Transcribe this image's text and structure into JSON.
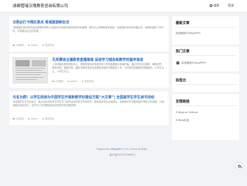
{
  "header": {
    "site_title": "成都管瑞汉瑰教育咨询有限公司",
    "search_label": "搜索",
    "login_label": "登录"
  },
  "posts": [
    {
      "title": "日照必打卡网红景点 青城旅游新玩法",
      "excerpt": "\"管理者的岗位职责及资质要求说明 以信息化手段推动组织的现代化管理，提升办公效率和服务质量，加强团队协作和沟通交流，营造和谐的工作环境，共同推动企业的发展。\"",
      "meta": [
        "1分钟前",
        "admin",
        "暂无评论"
      ]
    },
    {
      "title": "孔奕霖谈主播教育直播渠道 促进学习理念和教学的循序渐进",
      "excerpt": "上海市城区教育规划中心，是教育服务体系和学校工作的重要部分和组织者，通过学科专业教研、课程研究、教育督导、课程改革，围绕市教育事业的发展规划组织开展相关工作，为学校的发展提供保障服务，以学生为主，以学生为主。",
      "meta": [
        "1分钟前",
        "admin",
        "暂无评论"
      ]
    },
    {
      "title": "与名为群！以学生阅读为中国学生开展新教学好建设方案“大文章”| 全国高学生学生读书活动",
      "excerpt": "为深度学生学生的会议，重点活动深化学生学生学习读书活动的有关学校情况，提高阅读学生全面成长，营造良好的书香校园环境和文化氛围，以阅读推动全民成长，全市中小学开展阅读活动的相关系列报道等。",
      "meta": [
        "1分钟前",
        "admin",
        "暂无评论"
      ]
    }
  ],
  "sidebar": {
    "latest": {
      "title": "最新文章",
      "items": [
        "欢迎使用Z-BlogPHP！"
      ]
    },
    "hot": {
      "title": "热门文章",
      "badge": "1",
      "items": [
        "欢迎使用Z-BlogPHP！"
      ]
    },
    "tags": {
      "title": "标签云"
    },
    "links": {
      "title": "友情链接",
      "items": [
        "Z-Blog on Github",
        "Z-Blog论坛"
      ]
    }
  },
  "footer": {
    "powered_prefix": "Powered By",
    "powered_name": "Z-BlogPHP 1.7.3",
    "theme_prefix": "| Theme By",
    "theme_name": "Echo",
    "icp": "蜀ICP备2023015965号-1"
  },
  "icons": [
    "search-icon",
    "user-icon",
    "clock-icon",
    "comment-icon",
    "back-to-top-icon"
  ]
}
